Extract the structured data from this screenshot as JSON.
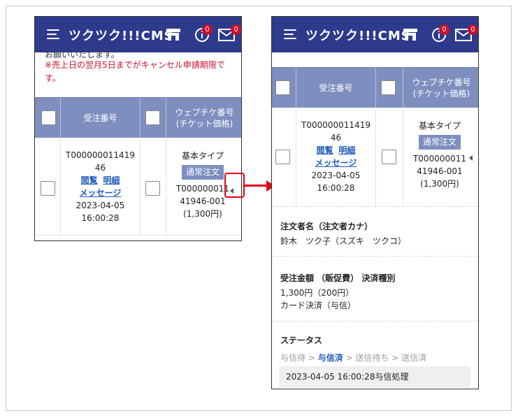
{
  "app": {
    "brand": "ツクツク!!!CMS"
  },
  "badges": {
    "info_count": "0",
    "mail_count": "0"
  },
  "left_screen": {
    "notice_cut": "お願いいたします。",
    "notice_red": "※売上日の翌月5日までがキャンセル申請期限です。",
    "header": {
      "order_no": "受注番号",
      "web_ticket": "ウェブチケ番号\n(チケット価格)"
    },
    "row": {
      "order_no_line1": "T000000011419",
      "order_no_line2": "46",
      "link_view": "閲覧",
      "link_detail": "明細",
      "link_message": "メッセージ",
      "date": "2023-04-05",
      "time": "16:00:28",
      "type_label": "基本タイプ",
      "type_badge": "通常注文",
      "ticket_line1": "T000000011",
      "ticket_line2": "41946-001",
      "ticket_price": "(1,300円)"
    }
  },
  "right_screen": {
    "header": {
      "order_no": "受注番号",
      "web_ticket": "ウェブチケ番号\n(チケット価格)"
    },
    "row": {
      "order_no_line1": "T000000011419",
      "order_no_line2": "46",
      "link_view": "閲覧",
      "link_detail": "明細",
      "link_message": "メッセージ",
      "date": "2023-04-05",
      "time": "16:00:28",
      "type_label": "基本タイプ",
      "type_badge": "通常注文",
      "ticket_line1": "T000000011",
      "ticket_line2": "41946-001",
      "ticket_price": "(1,300円)"
    },
    "orderer": {
      "title": "注文者名（注文者カナ）",
      "value": "鈴木　ツク子（スズキ　ツクコ）"
    },
    "amount": {
      "title": "受注金額 （販促費） 決済種別",
      "value1": "1,300円（200円）",
      "value2": "カード決済（与信）"
    },
    "status": {
      "title": "ステータス",
      "step1": "与信待",
      "step2": "与信済",
      "step3": "送信待ち",
      "step4": "送信済",
      "separator": " > ",
      "log": "2023-04-05 16:00:28与信処理"
    }
  },
  "colors": {
    "appbar": "#2e3a8c",
    "table_header": "#7e8fbf",
    "alert_red": "#c8102e",
    "link": "#1f5cb8",
    "callout": "#e60012"
  },
  "icons": [
    "menu-icon",
    "store-icon",
    "info-icon",
    "mail-icon",
    "checkbox-icon",
    "caret-left-icon",
    "arrow-right-icon"
  ]
}
